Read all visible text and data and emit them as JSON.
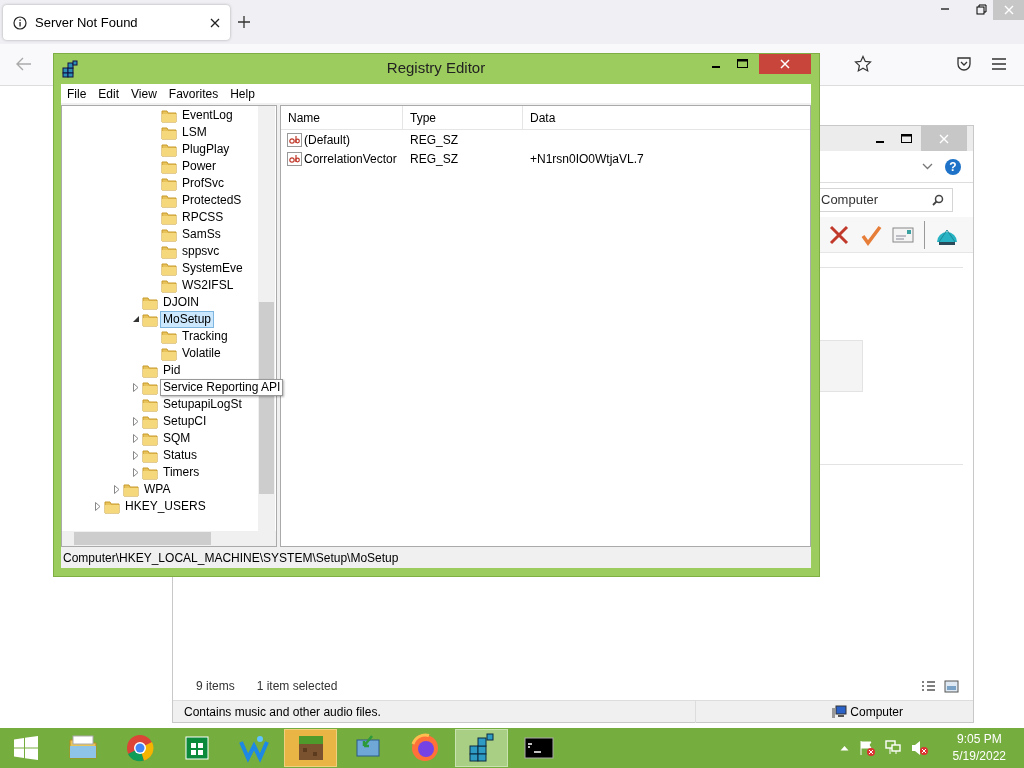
{
  "browser": {
    "tab": {
      "title": "Server Not Found"
    }
  },
  "explorer": {
    "help": "?",
    "search": {
      "value": "Computer"
    },
    "footer": {
      "count": "9 items",
      "selection": "1 item selected"
    },
    "status_bar": {
      "description": "Contains music and other audio files.",
      "location": "Computer"
    }
  },
  "regedit": {
    "title": "Registry Editor",
    "menu": [
      "File",
      "Edit",
      "View",
      "Favorites",
      "Help"
    ],
    "tree": [
      {
        "children": [
          {
            "children": [
              {
                "children": [
                  {
                    "label": "EventLog",
                    "selected": false
                  },
                  {
                    "label": "LSM",
                    "selected": false
                  },
                  {
                    "label": "PlugPlay",
                    "selected": false
                  },
                  {
                    "label": "Power",
                    "selected": false
                  },
                  {
                    "label": "ProfSvc",
                    "selected": false
                  },
                  {
                    "label": "ProtectedS",
                    "selected": false
                  },
                  {
                    "label": "RPCSS",
                    "selected": false
                  },
                  {
                    "label": "SamSs",
                    "selected": false
                  },
                  {
                    "label": "sppsvc",
                    "selected": false
                  },
                  {
                    "label": "SystemEve",
                    "selected": false
                  },
                  {
                    "label": "WS2IFSL",
                    "selected": false
                  }
                ]
              },
              {
                "label": "DJOIN",
                "selected": false
              },
              {
                "label": "MoSetup",
                "selected": true,
                "expanded": true,
                "children": [
                  {
                    "label": "Tracking",
                    "selected": false
                  },
                  {
                    "label": "Volatile",
                    "selected": false
                  }
                ]
              },
              {
                "label": "Pid",
                "selected": false
              },
              {
                "label": "Service Reporting API",
                "selected": false,
                "expanded": false,
                "tooltip": true
              },
              {
                "label": "SetupapiLogSt",
                "selected": false
              },
              {
                "label": "SetupCI",
                "selected": false,
                "expanded": false
              },
              {
                "label": "SQM",
                "selected": false,
                "expanded": false
              },
              {
                "label": "Status",
                "selected": false,
                "expanded": false
              },
              {
                "label": "Timers",
                "selected": false,
                "expanded": false
              }
            ]
          },
          {
            "label": "WPA",
            "selected": false,
            "expanded": false
          }
        ]
      },
      {
        "label": "HKEY_USERS",
        "selected": false,
        "expanded": false
      }
    ],
    "columns": [
      "Name",
      "Type",
      "Data"
    ],
    "values": [
      {
        "name": "(Default)",
        "type": "REG_SZ"
      },
      {
        "name": "CorrelationVector",
        "type": "REG_SZ",
        "data": "+N1rsn0IO0WtjaVL.7"
      }
    ],
    "status_bar": "Computer\\HKEY_LOCAL_MACHINE\\SYSTEM\\Setup\\MoSetup"
  },
  "taskbar": {
    "apps": [
      {
        "kind": "explorer",
        "active": false,
        "flashing": false
      },
      {
        "kind": "chrome",
        "active": false,
        "flashing": false
      },
      {
        "kind": "store",
        "active": false,
        "flashing": false
      },
      {
        "kind": "waterfox",
        "active": false,
        "flashing": false
      },
      {
        "kind": "minecraft",
        "active": false,
        "flashing": true
      },
      {
        "kind": "installer",
        "active": false,
        "flashing": false
      },
      {
        "kind": "firefox",
        "active": false,
        "flashing": false
      },
      {
        "kind": "regedit",
        "active": true,
        "flashing": false
      },
      {
        "kind": "terminal",
        "active": false,
        "flashing": false
      }
    ],
    "clock": {
      "time": "9:05 PM",
      "date": "5/19/2022"
    }
  }
}
